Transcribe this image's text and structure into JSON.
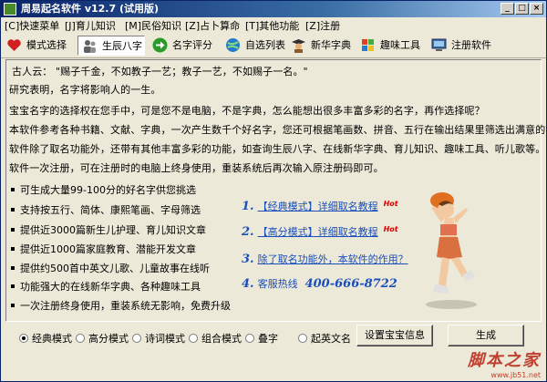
{
  "window": {
    "title": "周易起名软件 v12.7 (试用版)"
  },
  "menu": [
    "[C]快速菜单",
    "[J]育儿知识",
    "[M]民俗知识",
    "[Z]占卜算命",
    "[T]其他功能",
    "[Z]注册"
  ],
  "toolbar": [
    {
      "label": "模式选择",
      "icon": "heart-icon",
      "color": "#d02020"
    },
    {
      "label": "生辰八字",
      "icon": "people-icon",
      "color": "#606060"
    },
    {
      "label": "名字评分",
      "icon": "arrow-right-icon",
      "color": "#2a9a2a"
    },
    {
      "label": "自选列表",
      "icon": "globe-icon",
      "color": "#2a7acc"
    },
    {
      "label": "新华字典",
      "icon": "scholar-icon",
      "color": "#8a5a2a"
    },
    {
      "label": "趣味工具",
      "icon": "windows-flag-icon",
      "color": "#2a8acc"
    },
    {
      "label": "注册软件",
      "icon": "monitor-icon",
      "color": "#3a6aaa"
    }
  ],
  "intro": {
    "quote": "古人云：  \"赐子千金，不如教子一艺；教子一艺，不如赐子一名。\"",
    "line1": "研究表明，名字将影响人的一生。",
    "line2": "宝宝名字的选择权在您手中，可是您不是电脑，不是字典，怎么能想出很多丰富多彩的名字，再作选择呢？",
    "line3": "本软件参考各种书籍、文献、字典，一次产生数千个好名字，您还可根据笔画数、拼音、五行在输出结果里筛选出满意的名字",
    "line4": "软件除了取名功能外，还带有其他丰富多彩的功能，如查询生辰八字、在线新华字典、育儿知识、趣味工具、听儿歌等。",
    "line5": "软件一次注册，可在注册时的电脑上终身使用，重装系统后再次输入原注册码即可。"
  },
  "bullets": [
    "可生成大量99-100分的好名字供您挑选",
    "支持按五行、简体、康熙笔画、字母筛选",
    "提供近3000篇新生儿护理、育儿知识文章",
    "提供近1000篇家庭教育、潜能开发文章",
    "提供约500首中英文儿歌、儿童故事在线听",
    "功能强大的在线新华字典、各种趣味工具",
    "一次注册终身使用，重装系统无影响，免费升级"
  ],
  "links": [
    {
      "num": "1.",
      "text": "【经典模式】详细取名教程",
      "hot": "Hot"
    },
    {
      "num": "2.",
      "text": "【高分模式】详细取名教程",
      "hot": "Hot"
    },
    {
      "num": "3.",
      "text": "除了取名功能外，本软件的作用？"
    },
    {
      "num": "4.",
      "text": "客服热线",
      "phone": "400-666-8722"
    }
  ],
  "modes": [
    {
      "label": "经典模式",
      "selected": true
    },
    {
      "label": "高分模式",
      "selected": false
    },
    {
      "label": "诗词模式",
      "selected": false
    },
    {
      "label": "组合模式",
      "selected": false
    },
    {
      "label": "叠字",
      "selected": false
    },
    {
      "label": "起英文名",
      "selected": false
    }
  ],
  "buttons": {
    "setup": "设置宝宝信息",
    "generate": "生成"
  },
  "watermark": {
    "site": "脚本之家",
    "url": "www.jb51.net"
  }
}
